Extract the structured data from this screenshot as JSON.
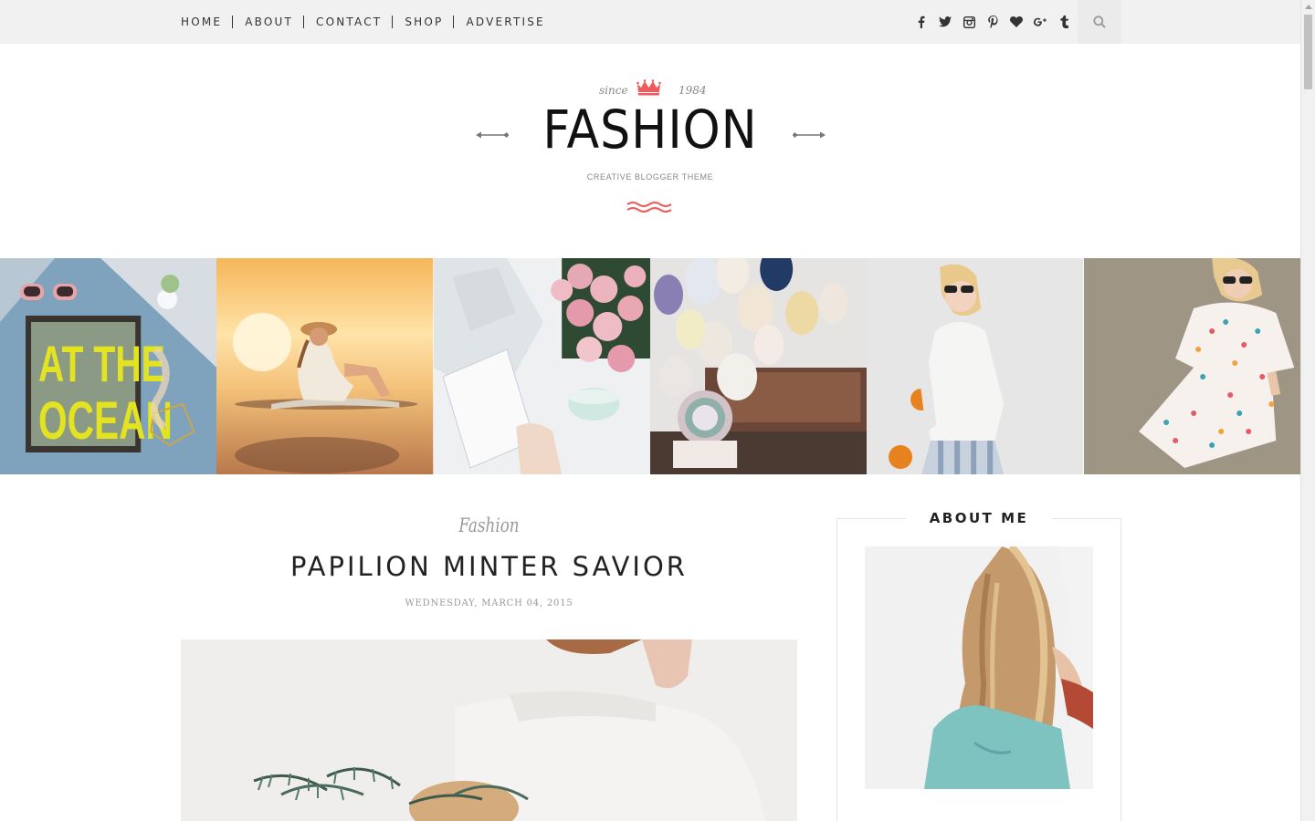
{
  "nav": {
    "items": [
      {
        "label": "HOME"
      },
      {
        "label": "ABOUT"
      },
      {
        "label": "CONTACT"
      },
      {
        "label": "SHOP"
      },
      {
        "label": "ADVERTISE"
      }
    ]
  },
  "social": {
    "icons": [
      "facebook-icon",
      "twitter-icon",
      "instagram-icon",
      "pinterest-icon",
      "bloglovin-heart-icon",
      "google-plus-icon",
      "tumblr-icon",
      "search-icon"
    ]
  },
  "header": {
    "since_left": "since",
    "since_right": "1984",
    "logo": "FASHION",
    "tagline": "CREATIVE BLOGGER THEME",
    "accent_color": "#ef5a5a"
  },
  "gallery": {
    "overlay_text": [
      "AT THE",
      "OCEAN"
    ]
  },
  "post": {
    "category": "Fashion",
    "title": "PAPILION MINTER SAVIOR",
    "date": "WEDNESDAY, MARCH 04, 2015"
  },
  "sidebar": {
    "about_title": "ABOUT ME"
  }
}
